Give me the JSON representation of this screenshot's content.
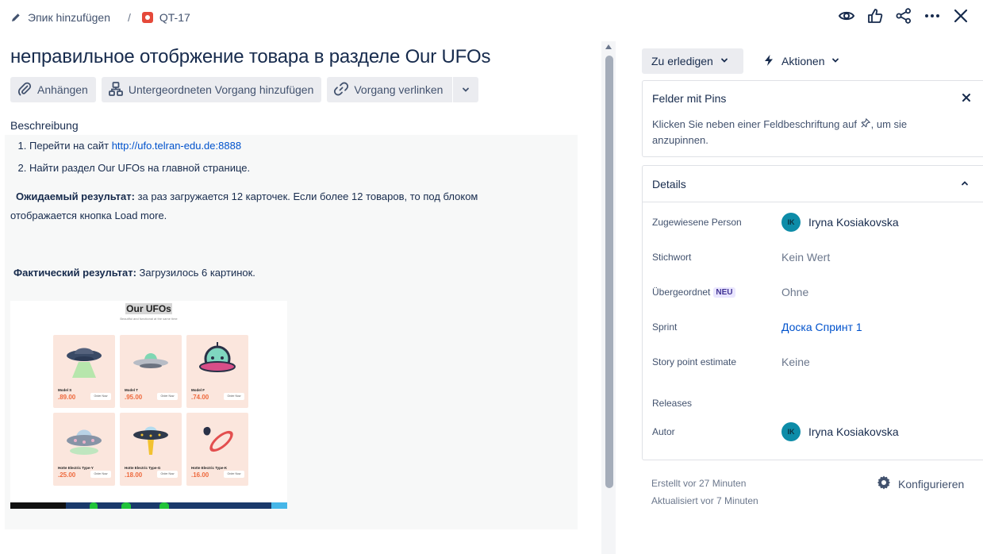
{
  "breadcrumb": {
    "epic_label": "Эпик hinzufügen",
    "separator": "/",
    "issue_key": "QT-17"
  },
  "top_icons": [
    "eye-icon",
    "thumbs-up-icon",
    "share-icon",
    "more-icon",
    "close-icon"
  ],
  "title": "неправильное отобржение товара в разделе Our UFOs",
  "toolbar": {
    "attach": "Anhängen",
    "child": "Untergeordneten Vorgang hinzufügen",
    "link": "Vorgang verlinken"
  },
  "description": {
    "label": "Beschreibung",
    "step1_prefix": "Перейти на сайт ",
    "step1_link": "http://ufo.telran-edu.de:8888",
    "step2": "Найти раздел Our UFOs на главной странице.",
    "expected_label": "Ожидаемый результат:",
    "expected_text_1": " за раз загружается 12 карточек. Если более 12 товаров, то под блоком",
    "expected_text_2": "отображается кнопка Load more.",
    "actual_label": "Фактический результат:",
    "actual_text": "  Загрузилось 6 картинок."
  },
  "screenshot": {
    "heading": "Our UFOs",
    "subheading": "Beautiful and functional at the same time",
    "order_label": "Order Now",
    "cards": [
      {
        "name": "Model S",
        "price": ".89.00"
      },
      {
        "name": "Model T",
        "price": ".95.00"
      },
      {
        "name": "Model F",
        "price": ".74.00"
      },
      {
        "name": "Hotte Electric Type-Y",
        "price": ".25.00"
      },
      {
        "name": "Hotte Electric Type-G",
        "price": ".18.00"
      },
      {
        "name": "Hotte Electric Type-K",
        "price": ".16.00"
      }
    ]
  },
  "right_panel": {
    "status": "Zu erledigen",
    "actions": "Aktionen",
    "pins_title": "Felder mit Pins",
    "pins_text": "Klicken Sie neben einer Feldbeschriftung auf",
    "pins_text_end": ", um sie anzupinnen.",
    "details_title": "Details",
    "fields": {
      "assignee_label": "Zugewiesene Person",
      "assignee_initials": "IK",
      "assignee_name": "Iryna Kosiakovska",
      "labels_label": "Stichwort",
      "labels_value": "Kein Wert",
      "parent_label": "Übergeordnet",
      "parent_badge": "NEU",
      "parent_value": "Ohne",
      "sprint_label": "Sprint",
      "sprint_value": "Доска Спринт 1",
      "story_label": "Story point estimate",
      "story_value": "Keine",
      "releases_label": "Releases",
      "author_label": "Autor",
      "author_initials": "IK",
      "author_name": "Iryna Kosiakovska"
    },
    "created": "Erstellt vor 27 Minuten",
    "updated": "Aktualisiert vor 7 Minuten",
    "configure": "Konfigurieren"
  },
  "colors": {
    "link": "#0052cc",
    "button_bg": "#ebecf0",
    "text": "#172b4d",
    "avatar": "#0d8ca8",
    "bug": "#e5493a",
    "price": "#ee6a3e"
  }
}
